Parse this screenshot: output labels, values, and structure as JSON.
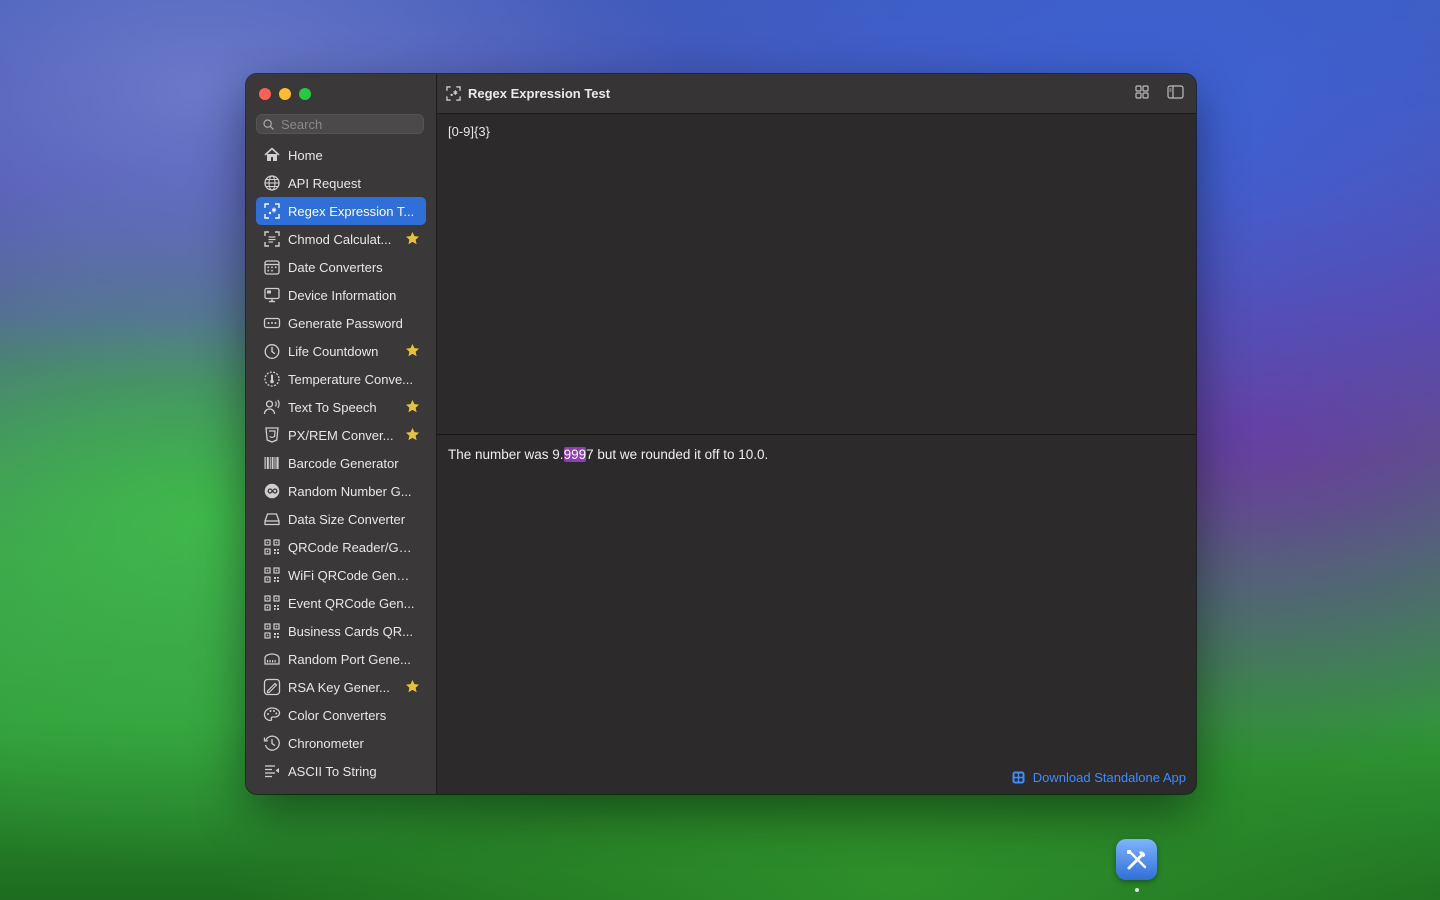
{
  "window": {
    "title": "Regex Expression Test"
  },
  "search": {
    "placeholder": "Search"
  },
  "sidebar": {
    "items": [
      {
        "label": "Home",
        "icon": "house-icon",
        "starred": false,
        "active": false
      },
      {
        "label": "API Request",
        "icon": "globe-icon",
        "starred": false,
        "active": false
      },
      {
        "label": "Regex Expression T...",
        "icon": "regex-scan-icon",
        "starred": false,
        "active": true
      },
      {
        "label": "Chmod Calculat...",
        "icon": "text-scan-icon",
        "starred": true,
        "active": false
      },
      {
        "label": "Date Converters",
        "icon": "calendar-icon",
        "starred": false,
        "active": false
      },
      {
        "label": "Device Information",
        "icon": "monitor-icon",
        "starred": false,
        "active": false
      },
      {
        "label": "Generate Password",
        "icon": "password-dots-icon",
        "starred": false,
        "active": false
      },
      {
        "label": "Life Countdown",
        "icon": "timer-icon",
        "starred": true,
        "active": false
      },
      {
        "label": "Temperature Conve...",
        "icon": "thermometer-gauge-icon",
        "starred": false,
        "active": false
      },
      {
        "label": "Text To Speech",
        "icon": "person-wave-icon",
        "starred": true,
        "active": false
      },
      {
        "label": "PX/REM Conver...",
        "icon": "css-shield-icon",
        "starred": true,
        "active": false
      },
      {
        "label": "Barcode Generator",
        "icon": "barcode-icon",
        "starred": false,
        "active": false
      },
      {
        "label": "Random Number G...",
        "icon": "infinity-circle-icon",
        "starred": false,
        "active": false
      },
      {
        "label": "Data Size Converter",
        "icon": "drive-icon",
        "starred": false,
        "active": false
      },
      {
        "label": "QRCode Reader/Ge...",
        "icon": "qrcode-icon",
        "starred": false,
        "active": false
      },
      {
        "label": "WiFi QRCode Gener...",
        "icon": "qrcode-icon",
        "starred": false,
        "active": false
      },
      {
        "label": "Event QRCode Gen...",
        "icon": "qrcode-icon",
        "starred": false,
        "active": false
      },
      {
        "label": "Business Cards QR...",
        "icon": "qrcode-icon",
        "starred": false,
        "active": false
      },
      {
        "label": "Random Port Gene...",
        "icon": "port-icon",
        "starred": false,
        "active": false
      },
      {
        "label": "RSA Key Gener...",
        "icon": "signature-icon",
        "starred": true,
        "active": false
      },
      {
        "label": "Color Converters",
        "icon": "palette-icon",
        "starred": false,
        "active": false
      },
      {
        "label": "Chronometer",
        "icon": "clock-history-icon",
        "starred": false,
        "active": false
      },
      {
        "label": "ASCII To String",
        "icon": "text-arrow-icon",
        "starred": false,
        "active": false
      }
    ]
  },
  "editor": {
    "pattern": "[0-9]{3}",
    "sample_before": "The number was 9.",
    "sample_match": "999",
    "sample_after": "7 but we rounded it off to 10.0."
  },
  "footer": {
    "download_label": "Download Standalone App"
  },
  "colors": {
    "accent": "#2f6fd9",
    "link": "#3f8cff",
    "match_highlight": "#8e3fb5",
    "star": "#e6c33a"
  }
}
